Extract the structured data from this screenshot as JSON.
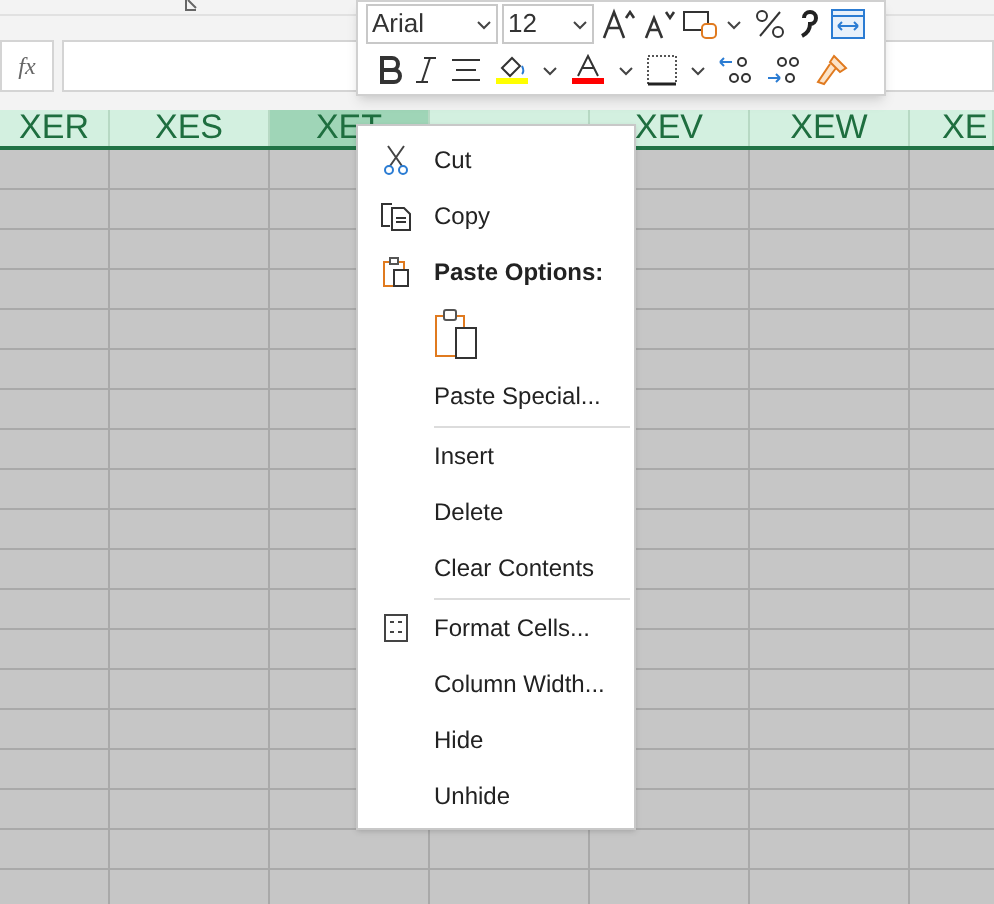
{
  "formula_bar": {
    "fx": "fx"
  },
  "columns": [
    {
      "label": "XER",
      "selected": false
    },
    {
      "label": "XES",
      "selected": false
    },
    {
      "label": "XET",
      "selected": true
    },
    {
      "selected": false
    },
    {
      "label": "XEV",
      "selected": false
    },
    {
      "label": "XEW",
      "selected": false
    },
    {
      "label": "XE",
      "selected": false
    }
  ],
  "mini_toolbar": {
    "font": "Arial",
    "size": "12"
  },
  "context_menu": [
    {
      "kind": "cut",
      "label": "Cut"
    },
    {
      "kind": "copy",
      "label": "Copy"
    },
    {
      "kind": "header",
      "label": "Paste Options:"
    },
    {
      "kind": "paste_icons"
    },
    {
      "kind": "plain",
      "label": "Paste Special..."
    },
    {
      "kind": "separator"
    },
    {
      "kind": "plain",
      "label": "Insert"
    },
    {
      "kind": "plain",
      "label": "Delete"
    },
    {
      "kind": "plain",
      "label": "Clear Contents"
    },
    {
      "kind": "separator"
    },
    {
      "kind": "format",
      "label": "Format Cells..."
    },
    {
      "kind": "plain",
      "label": "Column Width..."
    },
    {
      "kind": "plain",
      "label": "Hide"
    },
    {
      "kind": "plain",
      "label": "Unhide"
    }
  ]
}
